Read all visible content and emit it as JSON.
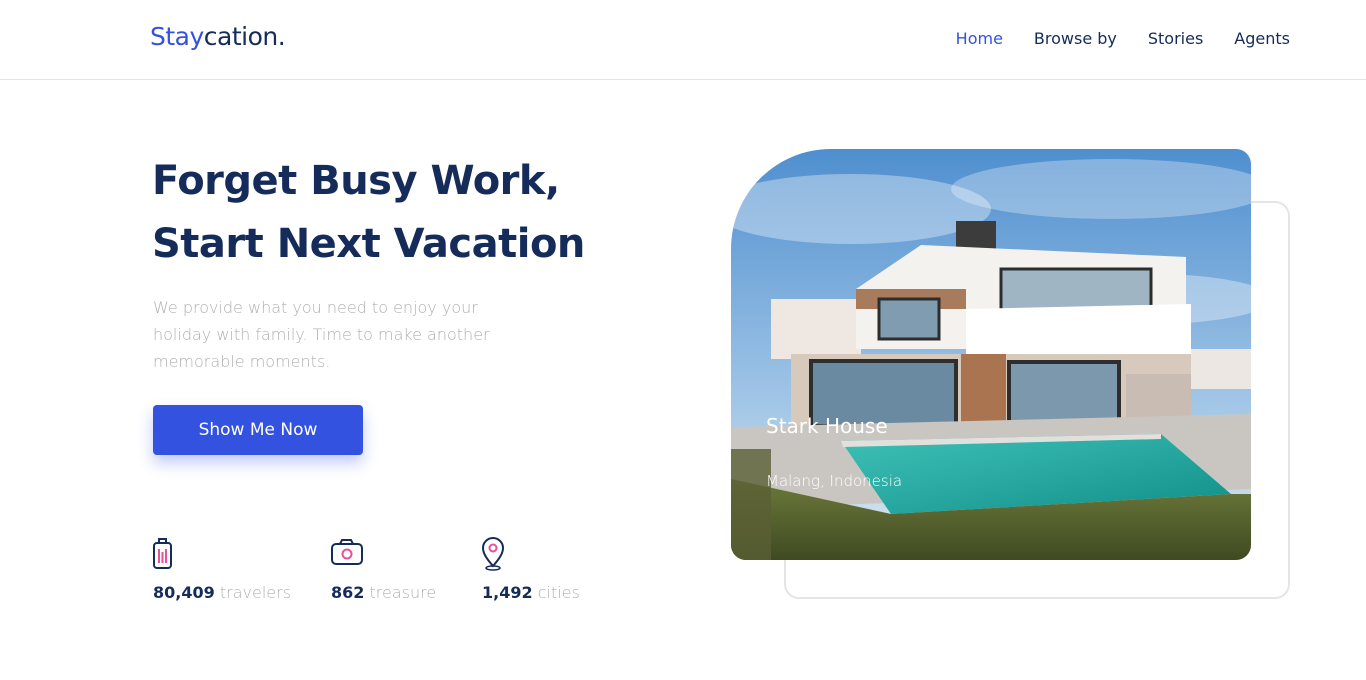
{
  "logo": {
    "part1": "Stay",
    "part2": "cation."
  },
  "nav": {
    "items": [
      {
        "label": "Home",
        "active": true
      },
      {
        "label": "Browse by"
      },
      {
        "label": "Stories"
      },
      {
        "label": "Agents"
      }
    ]
  },
  "hero": {
    "line1": "Forget Busy Work,",
    "line2": "Start Next Vacation",
    "description": "We provide what you need to enjoy your holiday with family. Time to make another memorable moments.",
    "cta": "Show Me Now"
  },
  "stats": [
    {
      "icon": "suitcase-icon",
      "value": "80,409",
      "unit": "travelers"
    },
    {
      "icon": "camera-icon",
      "value": "862",
      "unit": "treasure"
    },
    {
      "icon": "map-pin-icon",
      "value": "1,492",
      "unit": "cities"
    }
  ],
  "featured": {
    "title": "Stark House",
    "location": "Malang, Indonesia"
  },
  "colors": {
    "primary": "#3252df",
    "navy": "#152c5b",
    "gray": "#b0b0b0",
    "accent": "#e5519b"
  }
}
